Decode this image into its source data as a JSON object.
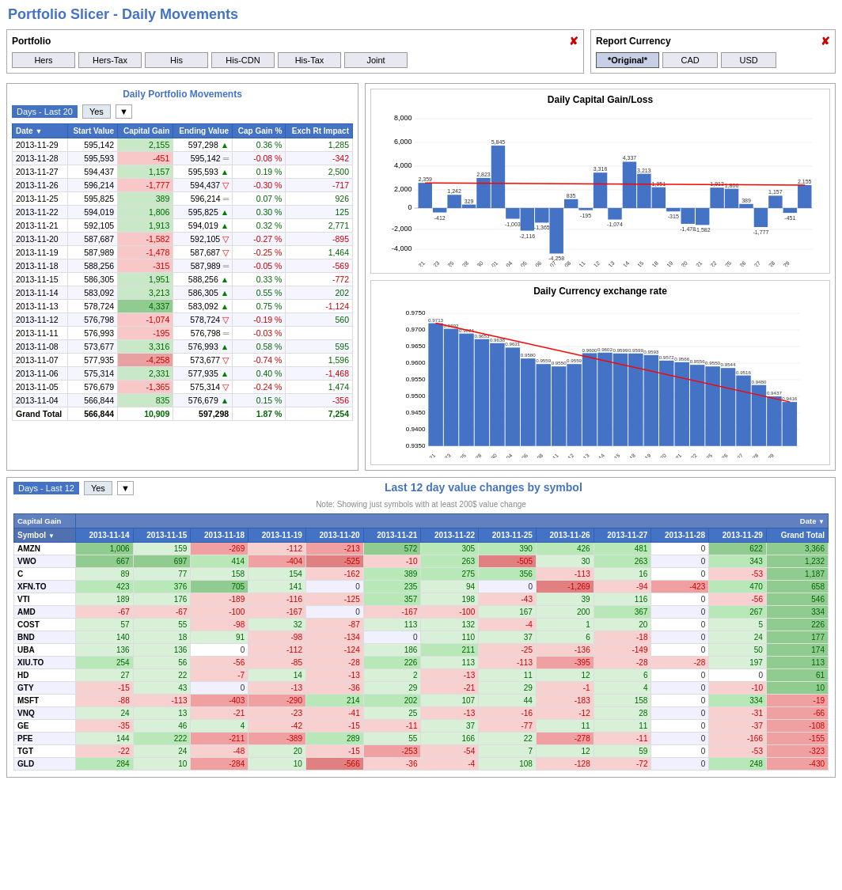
{
  "page": {
    "title": "Portfolio Slicer - Daily Movements"
  },
  "portfolio": {
    "label": "Portfolio",
    "pin_symbol": "✘",
    "buttons": [
      {
        "label": "Hers",
        "active": false
      },
      {
        "label": "Hers-Tax",
        "active": false
      },
      {
        "label": "His",
        "active": false
      },
      {
        "label": "His-CDN",
        "active": false
      },
      {
        "label": "His-Tax",
        "active": false
      },
      {
        "label": "Joint",
        "active": false
      }
    ]
  },
  "currency": {
    "label": "Report Currency",
    "pin_symbol": "✘",
    "buttons": [
      {
        "label": "*Original*",
        "active": true
      },
      {
        "label": "CAD",
        "active": false
      },
      {
        "label": "USD",
        "active": false
      }
    ]
  },
  "daily_movements": {
    "title": "Daily Portfolio Movements",
    "filter_label": "Days - Last 20",
    "filter_val": "Yes",
    "columns": [
      "Date",
      "Start Value",
      "Capital Gain",
      "Ending Value",
      "Cap Gain %",
      "Exch Rt Impact"
    ],
    "rows": [
      {
        "date": "2013-11-29",
        "start": "595,142",
        "gain": "2,155",
        "gain_class": "pos",
        "end": "597,298",
        "arrow": "up",
        "pct": "0.36 %",
        "exch": "1,285"
      },
      {
        "date": "2013-11-28",
        "start": "595,593",
        "gain": "-451",
        "gain_class": "neg",
        "end": "595,142",
        "arrow": "eq",
        "pct": "-0.08 %",
        "exch": "-342"
      },
      {
        "date": "2013-11-27",
        "start": "594,437",
        "gain": "1,157",
        "gain_class": "pos",
        "end": "595,593",
        "arrow": "up",
        "pct": "0.19 %",
        "exch": "2,500"
      },
      {
        "date": "2013-11-26",
        "start": "596,214",
        "gain": "-1,777",
        "gain_class": "neg",
        "end": "594,437",
        "arrow": "down",
        "pct": "-0.30 %",
        "exch": "-717"
      },
      {
        "date": "2013-11-25",
        "start": "595,825",
        "gain": "389",
        "gain_class": "pos",
        "end": "596,214",
        "arrow": "eq",
        "pct": "0.07 %",
        "exch": "926"
      },
      {
        "date": "2013-11-22",
        "start": "594,019",
        "gain": "1,806",
        "gain_class": "pos",
        "end": "595,825",
        "arrow": "up",
        "pct": "0.30 %",
        "exch": "125"
      },
      {
        "date": "2013-11-21",
        "start": "592,105",
        "gain": "1,913",
        "gain_class": "pos",
        "end": "594,019",
        "arrow": "up",
        "pct": "0.32 %",
        "exch": "2,771"
      },
      {
        "date": "2013-11-20",
        "start": "587,687",
        "gain": "-1,582",
        "gain_class": "neg",
        "end": "592,105",
        "arrow": "down",
        "pct": "-0.27 %",
        "exch": "-895"
      },
      {
        "date": "2013-11-19",
        "start": "587,989",
        "gain": "-1,478",
        "gain_class": "neg",
        "end": "587,687",
        "arrow": "down",
        "pct": "-0.25 %",
        "exch": "1,464"
      },
      {
        "date": "2013-11-18",
        "start": "588,256",
        "gain": "-315",
        "gain_class": "neg",
        "end": "587,989",
        "arrow": "eq",
        "pct": "-0.05 %",
        "exch": "-569"
      },
      {
        "date": "2013-11-15",
        "start": "586,305",
        "gain": "1,951",
        "gain_class": "pos",
        "end": "588,256",
        "arrow": "up",
        "pct": "0.33 %",
        "exch": "-772"
      },
      {
        "date": "2013-11-14",
        "start": "583,092",
        "gain": "3,213",
        "gain_class": "pos",
        "end": "586,305",
        "arrow": "up",
        "pct": "0.55 %",
        "exch": "202"
      },
      {
        "date": "2013-11-13",
        "start": "578,724",
        "gain": "4,337",
        "gain_class": "pos-strong",
        "end": "583,092",
        "arrow": "up",
        "pct": "0.75 %",
        "exch": "-1,124"
      },
      {
        "date": "2013-11-12",
        "start": "576,798",
        "gain": "-1,074",
        "gain_class": "neg",
        "end": "578,724",
        "arrow": "down",
        "pct": "-0.19 %",
        "exch": "560"
      },
      {
        "date": "2013-11-11",
        "start": "576,993",
        "gain": "-195",
        "gain_class": "neg",
        "end": "576,798",
        "arrow": "eq",
        "pct": "-0.03 %",
        "exch": ""
      },
      {
        "date": "2013-11-08",
        "start": "573,677",
        "gain": "3,316",
        "gain_class": "pos",
        "end": "576,993",
        "arrow": "up",
        "pct": "0.58 %",
        "exch": "595"
      },
      {
        "date": "2013-11-07",
        "start": "577,935",
        "gain": "-4,258",
        "gain_class": "neg-strong",
        "end": "573,677",
        "arrow": "down",
        "pct": "-0.74 %",
        "exch": "1,596"
      },
      {
        "date": "2013-11-06",
        "start": "575,314",
        "gain": "2,331",
        "gain_class": "pos",
        "end": "577,935",
        "arrow": "up",
        "pct": "0.40 %",
        "exch": "-1,468"
      },
      {
        "date": "2013-11-05",
        "start": "576,679",
        "gain": "-1,365",
        "gain_class": "neg",
        "end": "575,314",
        "arrow": "down",
        "pct": "-0.24 %",
        "exch": "1,474"
      },
      {
        "date": "2013-11-04",
        "start": "566,844",
        "gain": "835",
        "gain_class": "pos",
        "end": "576,679",
        "arrow": "up",
        "pct": "0.15 %",
        "exch": "-356"
      }
    ],
    "totals": {
      "label": "Grand Total",
      "start": "566,844",
      "gain": "10,909",
      "end": "597,298",
      "pct": "1.87 %",
      "exch": "7,254"
    }
  },
  "last12_title": "Last 12 day value changes by symbol",
  "last12_subtitle": "Note: Showing just symbols with at least 200$ value change",
  "last12_filter": "Days - Last 12",
  "last12_filter_val": "Yes",
  "symbol_table": {
    "col_header1": "Capital Gain",
    "col_header2": "Date",
    "date_cols": [
      "2013-11-14",
      "2013-11-15",
      "2013-11-18",
      "2013-11-19",
      "2013-11-20",
      "2013-11-21",
      "2013-11-22",
      "2013-11-25",
      "2013-11-26",
      "2013-11-27",
      "2013-11-28",
      "2013-11-29",
      "Grand Total"
    ],
    "rows": [
      {
        "sym": "AMZN",
        "vals": [
          1006,
          159,
          -269,
          -112,
          -213,
          572,
          305,
          390,
          426,
          481,
          0,
          622,
          3366
        ]
      },
      {
        "sym": "VWO",
        "vals": [
          667,
          697,
          414,
          -404,
          -525,
          -10,
          263,
          -505,
          30,
          263,
          0,
          343,
          1232
        ]
      },
      {
        "sym": "C",
        "vals": [
          89,
          77,
          158,
          154,
          -162,
          389,
          275,
          356,
          -113,
          16,
          0,
          -53,
          1187
        ]
      },
      {
        "sym": "XFN.TO",
        "vals": [
          423,
          376,
          705,
          141,
          0,
          235,
          94,
          0,
          -1269,
          -94,
          -423,
          470,
          658
        ]
      },
      {
        "sym": "VTI",
        "vals": [
          189,
          176,
          -189,
          -116,
          -125,
          357,
          198,
          -43,
          39,
          116,
          0,
          -56,
          546
        ]
      },
      {
        "sym": "AMD",
        "vals": [
          -67,
          -67,
          -100,
          -167,
          0,
          -167,
          -100,
          167,
          200,
          367,
          0,
          267,
          334
        ]
      },
      {
        "sym": "COST",
        "vals": [
          57,
          55,
          -98,
          32,
          -87,
          113,
          132,
          -4,
          1,
          20,
          0,
          5,
          226
        ]
      },
      {
        "sym": "BND",
        "vals": [
          140,
          18,
          91,
          -98,
          -134,
          0,
          110,
          37,
          6,
          -18,
          0,
          24,
          177
        ]
      },
      {
        "sym": "UBA",
        "vals": [
          136,
          136,
          0,
          -112,
          -124,
          186,
          211,
          -25,
          -136,
          -149,
          0,
          50,
          174
        ]
      },
      {
        "sym": "XIU.TO",
        "vals": [
          254,
          56,
          -56,
          -85,
          -28,
          226,
          113,
          -113,
          -395,
          -28,
          -28,
          197,
          113
        ]
      },
      {
        "sym": "HD",
        "vals": [
          27,
          22,
          -7,
          14,
          -13,
          2,
          -13,
          11,
          12,
          6,
          0,
          0,
          61
        ]
      },
      {
        "sym": "GTY",
        "vals": [
          -15,
          43,
          0,
          -13,
          -36,
          29,
          -21,
          29,
          -1,
          4,
          0,
          -10,
          10
        ]
      },
      {
        "sym": "MSFT",
        "vals": [
          -88,
          -113,
          -403,
          -290,
          214,
          202,
          107,
          44,
          -183,
          158,
          0,
          334,
          -19
        ]
      },
      {
        "sym": "VNQ",
        "vals": [
          24,
          13,
          -21,
          -23,
          -41,
          25,
          -13,
          -16,
          -12,
          28,
          0,
          -31,
          -66
        ]
      },
      {
        "sym": "GE",
        "vals": [
          -35,
          46,
          4,
          -42,
          -15,
          -11,
          37,
          -77,
          11,
          11,
          0,
          -37,
          -108
        ]
      },
      {
        "sym": "PFE",
        "vals": [
          144,
          222,
          -211,
          -389,
          289,
          55,
          166,
          22,
          -278,
          -11,
          0,
          -166,
          -155
        ]
      },
      {
        "sym": "TGT",
        "vals": [
          -22,
          24,
          -48,
          20,
          -15,
          -253,
          -54,
          7,
          12,
          59,
          0,
          -53,
          -323
        ]
      },
      {
        "sym": "GLD",
        "vals": [
          284,
          10,
          -284,
          10,
          -566,
          -36,
          -4,
          108,
          -128,
          -72,
          0,
          248,
          -430
        ]
      }
    ]
  }
}
